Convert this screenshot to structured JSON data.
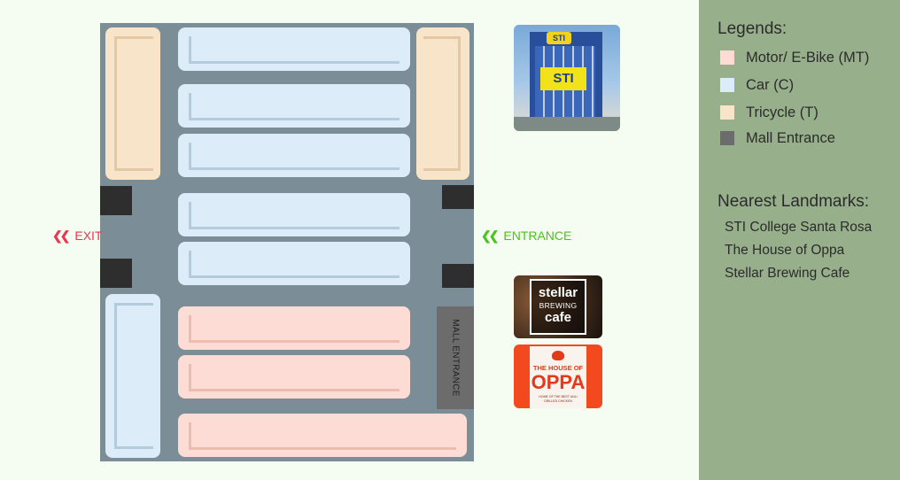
{
  "gates": {
    "exit": {
      "icon": "double-chevron-left-icon",
      "label": "EXIT",
      "color": "#e8384f"
    },
    "entrance": {
      "icon": "double-chevron-left-icon",
      "label": "ENTRANCE",
      "color": "#4cc21f"
    }
  },
  "mall_entrance_label": "MALL ENTRANCE",
  "colors": {
    "motor": "#fcdcd4",
    "car": "#dcecf8",
    "tricycle": "#f8e4c8",
    "mall_entrance": "#6c6c6c",
    "lane": "#7b8e98",
    "panel": "#97b08b"
  },
  "legend": {
    "heading": "Legends:",
    "items": [
      {
        "label": "Motor/ E-Bike (MT)",
        "color": "#fcdcd4"
      },
      {
        "label": "Car (C)",
        "color": "#dcecf8"
      },
      {
        "label": "Tricycle (T)",
        "color": "#f8e4c8"
      },
      {
        "label": "Mall Entrance",
        "color": "#6c6c6c"
      }
    ]
  },
  "landmarks": {
    "heading": "Nearest Landmarks:",
    "items": [
      "STI College Santa Rosa",
      "The House of Oppa",
      "Stellar Brewing Cafe"
    ]
  },
  "thumbnails": {
    "sti": {
      "sign_top": "STI",
      "sign_main": "STI"
    },
    "stellar": {
      "line1": "stellar",
      "line2": "BREWING",
      "line3": "cafe"
    },
    "oppa": {
      "line1": "THE HOUSE OF",
      "line2": "OPPA",
      "tagline": "HOME OF THE BEST UNLI GRILLED CHICKEN"
    }
  }
}
